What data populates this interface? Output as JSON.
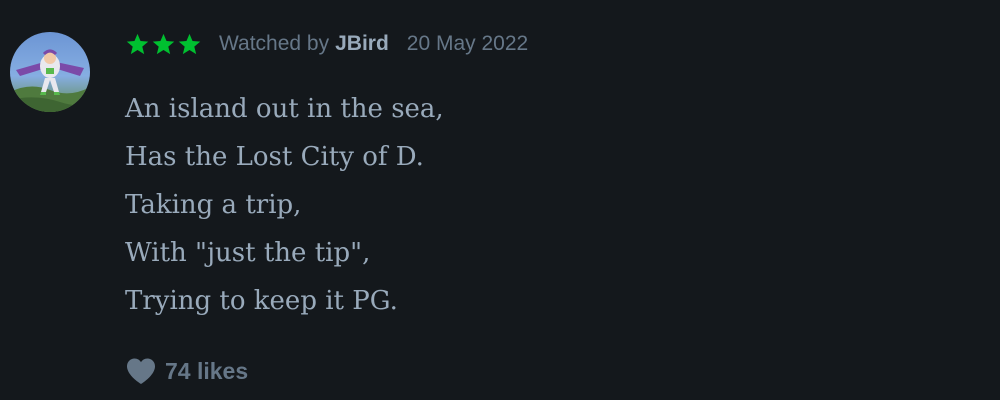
{
  "review": {
    "rating_stars": 3,
    "star_color": "#00c030",
    "meta": {
      "watched_label": "Watched by",
      "username": "JBird",
      "date": "20 May 2022"
    },
    "body_lines": [
      "An island out in the sea,",
      "Has the Lost City of D.",
      "Taking a trip,",
      "With \"just the tip\",",
      "Trying to keep it PG."
    ],
    "likes": {
      "icon": "heart-icon",
      "label": "74 likes"
    }
  },
  "colors": {
    "background": "#14181c",
    "text_primary": "#99aabb",
    "text_muted": "#667788",
    "accent_green": "#00c030"
  }
}
